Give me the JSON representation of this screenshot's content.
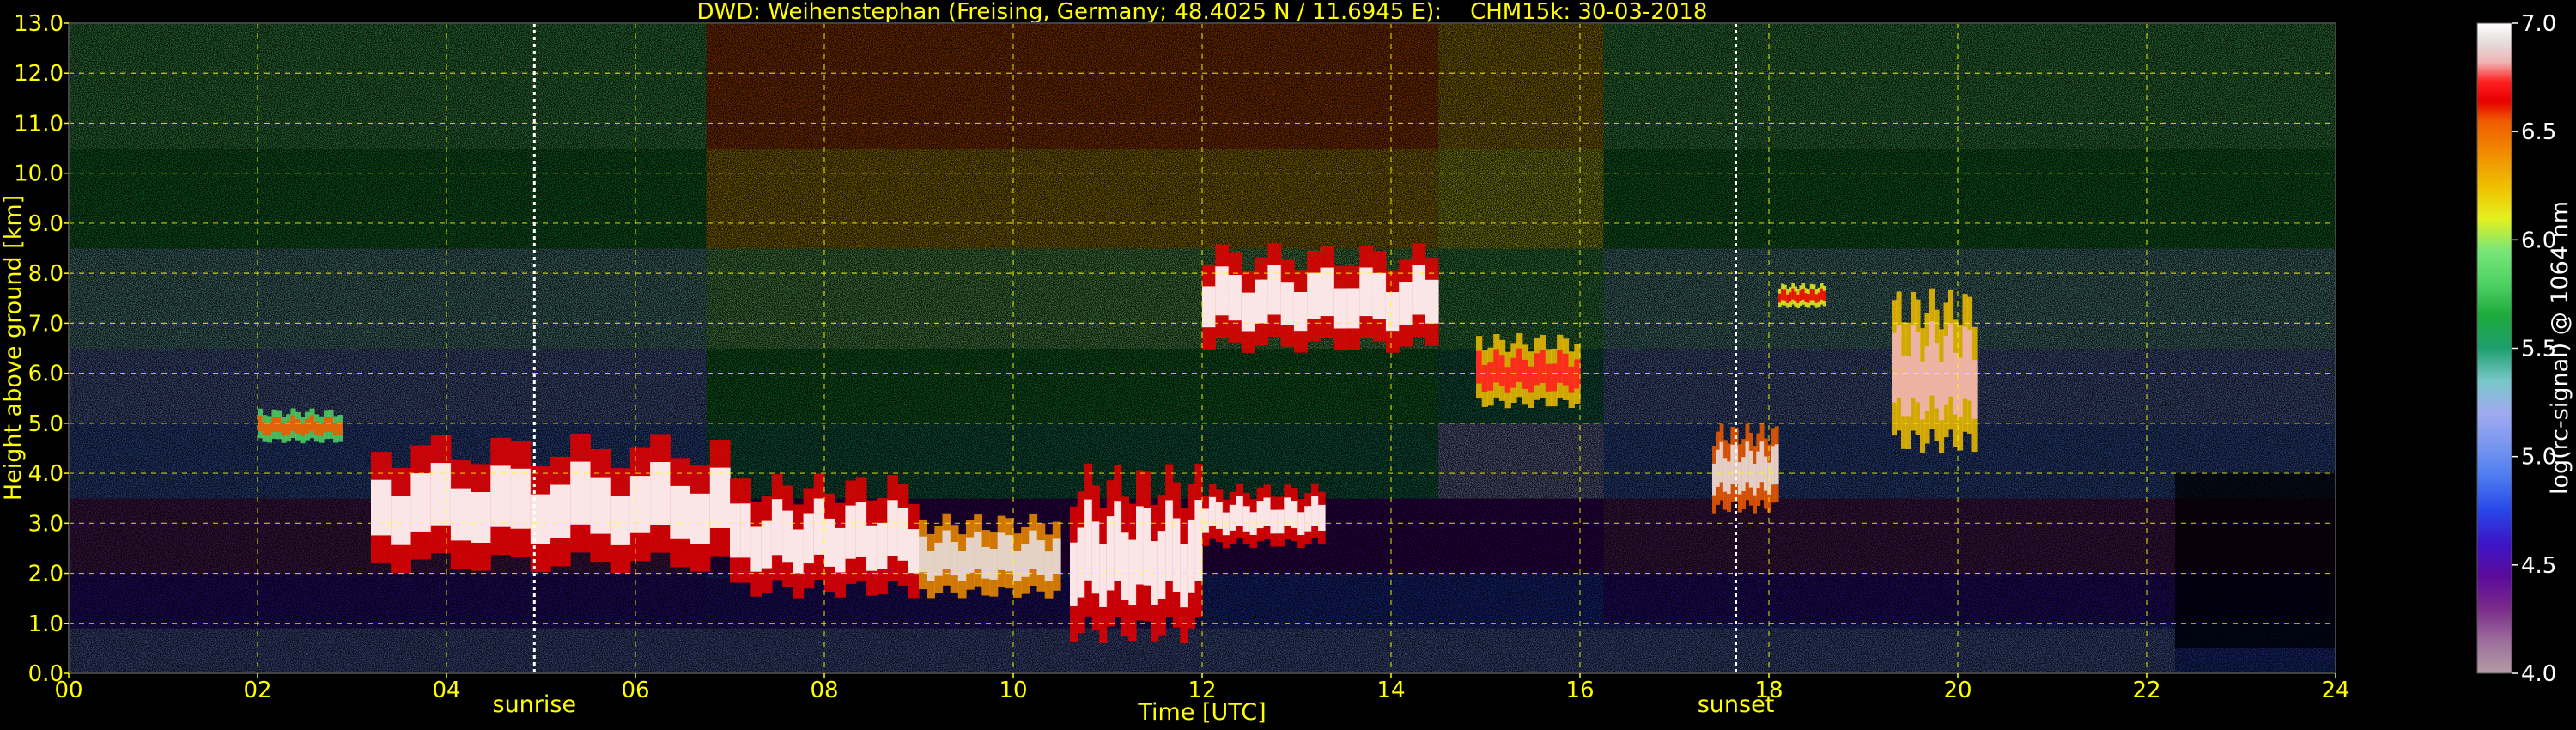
{
  "chart_data": {
    "type": "heatmap",
    "title": "DWD: Weihenstephan (Freising, Germany; 48.4025 N / 11.6945 E):    CHM15k: 30-03-2018",
    "xlabel": "Time [UTC]",
    "ylabel": "Height above ground [km]",
    "colorbar_label": "log(rc-signal) @ 1064 nm",
    "xlim": [
      0,
      24
    ],
    "ylim": [
      0,
      13
    ],
    "clim": [
      4.0,
      7.0
    ],
    "x_ticks": [
      0,
      2,
      4,
      6,
      8,
      10,
      12,
      14,
      16,
      18,
      20,
      22,
      24
    ],
    "x_tick_labels": [
      "00",
      "02",
      "04",
      "06",
      "08",
      "10",
      "12",
      "14",
      "16",
      "18",
      "20",
      "22",
      "24"
    ],
    "y_ticks": [
      0,
      1,
      2,
      3,
      4,
      5,
      6,
      7,
      8,
      9,
      10,
      11,
      12,
      13
    ],
    "y_tick_labels": [
      "0.0",
      "1.0",
      "2.0",
      "3.0",
      "4.0",
      "5.0",
      "6.0",
      "7.0",
      "8.0",
      "9.0",
      "10.0",
      "11.0",
      "12.0",
      "13.0"
    ],
    "colorbar_ticks": [
      4.0,
      4.5,
      5.0,
      5.5,
      6.0,
      6.5,
      7.0
    ],
    "colorbar_tick_labels": [
      "4.0",
      "4.5",
      "5.0",
      "5.5",
      "6.0",
      "6.5",
      "7.0"
    ],
    "colormap": [
      "#b49ba5",
      "#9c6e9c",
      "#7a2a8a",
      "#5a0a9a",
      "#3c16c8",
      "#2846e8",
      "#4a7af0",
      "#7896f0",
      "#a0aaf0",
      "#78c8c8",
      "#1e9e6e",
      "#1eaa3c",
      "#50d264",
      "#78e678",
      "#e6f01e",
      "#f0be00",
      "#f08c00",
      "#f05a00",
      "#e60000",
      "#ff2020",
      "#f0b4b4",
      "#e6dcdc",
      "#ffffff"
    ],
    "grid": true,
    "grid_color": "#ffff00",
    "markers": [
      {
        "label": "sunrise",
        "x": 4.93
      },
      {
        "label": "sunset",
        "x": 17.65
      }
    ],
    "cloud_layers": [
      {
        "x_start": 2.0,
        "x_end": 2.9,
        "base": 4.6,
        "top": 5.3,
        "peak_log": 6.3
      },
      {
        "x_start": 3.2,
        "x_end": 7.0,
        "base": 2.0,
        "top": 4.8,
        "peak_log": 7.0
      },
      {
        "x_start": 7.0,
        "x_end": 9.0,
        "base": 1.5,
        "top": 4.0,
        "peak_log": 7.0
      },
      {
        "x_start": 9.0,
        "x_end": 10.5,
        "base": 1.5,
        "top": 3.2,
        "peak_log": 6.8
      },
      {
        "x_start": 10.6,
        "x_end": 12.0,
        "base": 0.6,
        "top": 4.2,
        "peak_log": 7.0
      },
      {
        "x_start": 12.0,
        "x_end": 13.3,
        "base": 2.5,
        "top": 3.8,
        "peak_log": 7.0
      },
      {
        "x_start": 12.0,
        "x_end": 14.5,
        "base": 6.4,
        "top": 8.6,
        "peak_log": 7.0
      },
      {
        "x_start": 14.9,
        "x_end": 16.0,
        "base": 5.3,
        "top": 6.8,
        "peak_log": 6.6
      },
      {
        "x_start": 17.4,
        "x_end": 18.1,
        "base": 3.2,
        "top": 5.0,
        "peak_log": 6.9
      },
      {
        "x_start": 18.1,
        "x_end": 18.6,
        "base": 7.3,
        "top": 7.8,
        "peak_log": 6.5
      },
      {
        "x_start": 19.3,
        "x_end": 20.2,
        "base": 4.4,
        "top": 7.7,
        "peak_log": 6.7
      }
    ],
    "boundary_layer": {
      "top_morning": 1.9,
      "top_afternoon": 1.0,
      "log_level": 4.6
    },
    "weak_signal_region": {
      "x_start": 22.3,
      "x_end": 24.0,
      "below_km": 0.5
    }
  }
}
